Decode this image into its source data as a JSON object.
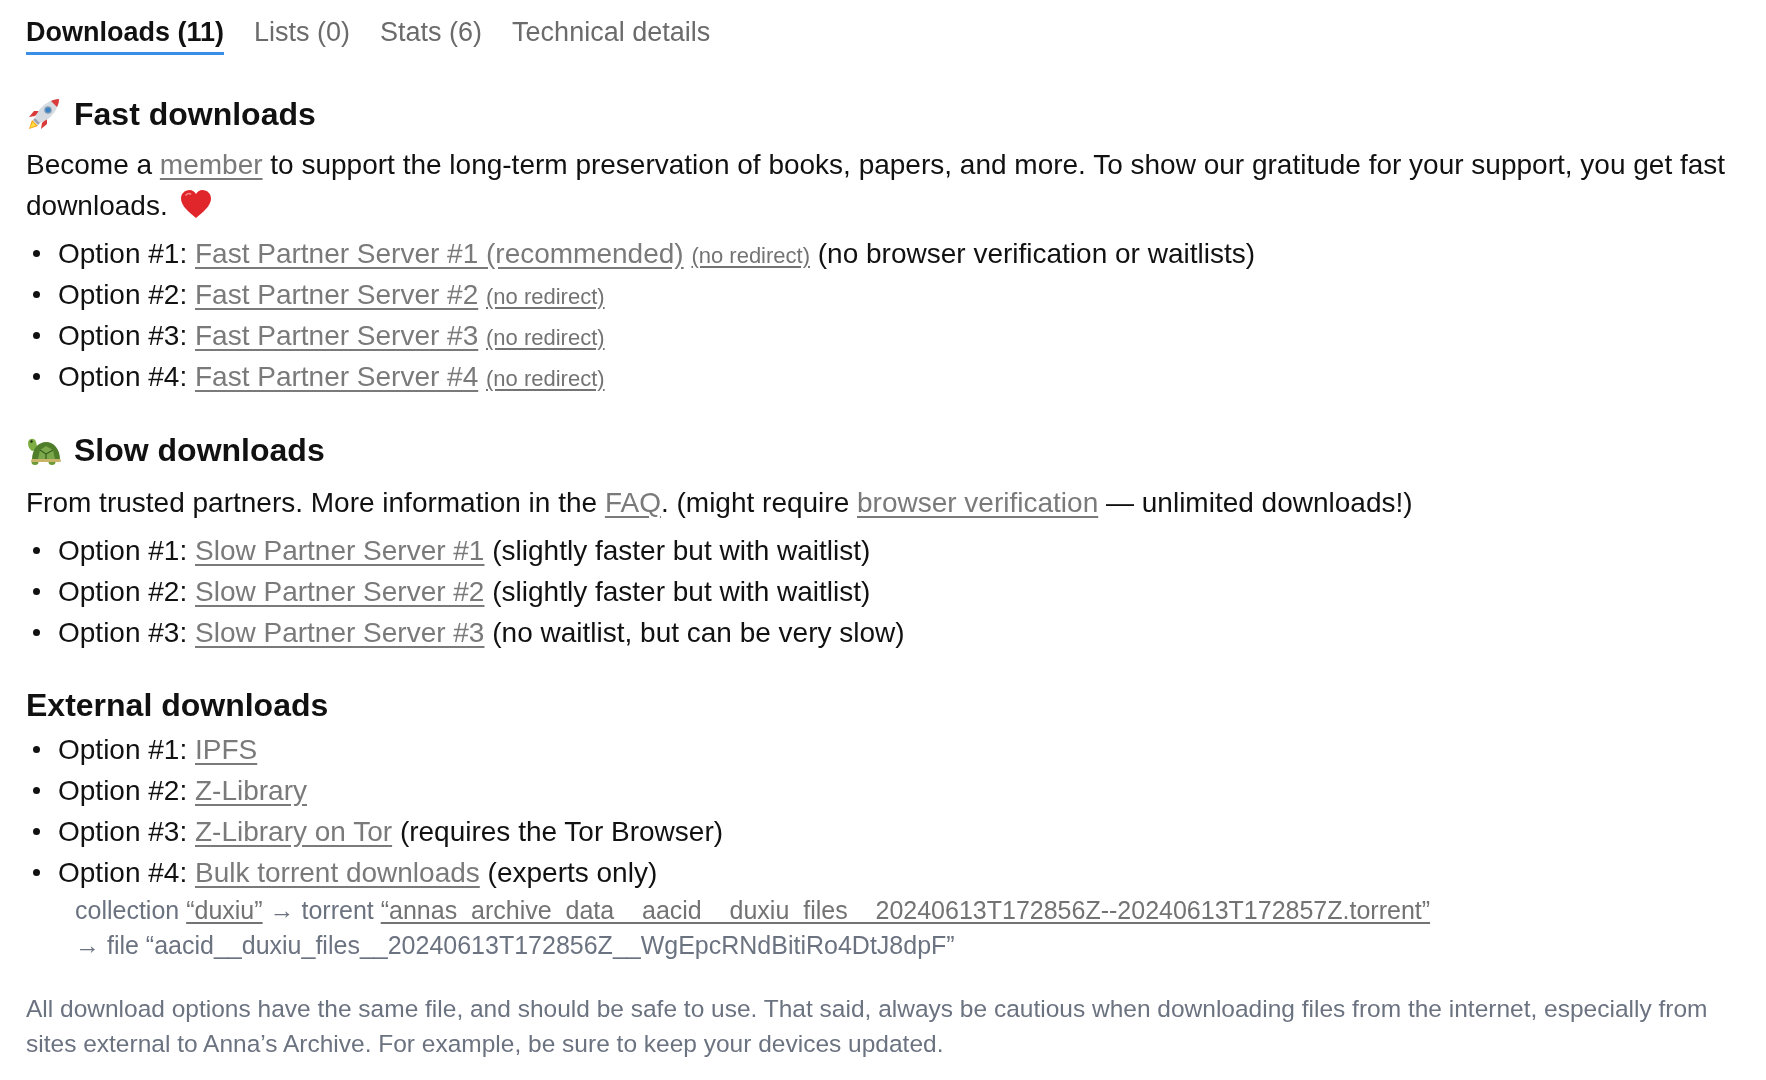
{
  "tabs": [
    {
      "label": "Downloads (11)",
      "selected": true
    },
    {
      "label": "Lists (0)",
      "selected": false
    },
    {
      "label": "Stats (6)",
      "selected": false
    },
    {
      "label": "Technical details",
      "selected": false
    }
  ],
  "sections": [
    {
      "kind": "fast",
      "title": "Fast downloads",
      "intro": [
        {
          "kind": "text",
          "text": "Become a "
        },
        {
          "kind": "link",
          "text": "member"
        },
        {
          "kind": "text",
          "text": " to support the long-term preservation of books, papers, and more. To show our gratitude for your support, you get fast downloads."
        }
      ],
      "options": [
        {
          "label": "Option #1:",
          "link": "Fast Partner Server #1 (recommended)",
          "extra_link": "(no redirect)",
          "note": "(no browser verification or waitlists)"
        },
        {
          "label": "Option #2:",
          "link": "Fast Partner Server #2",
          "extra_link": "(no redirect)"
        },
        {
          "label": "Option #3:",
          "link": "Fast Partner Server #3",
          "extra_link": "(no redirect)"
        },
        {
          "label": "Option #4:",
          "link": "Fast Partner Server #4",
          "extra_link": "(no redirect)"
        }
      ]
    },
    {
      "kind": "slow",
      "title": "Slow downloads",
      "intro": [
        {
          "kind": "text",
          "text": "From trusted partners. More information in the "
        },
        {
          "kind": "link",
          "text": "FAQ"
        },
        {
          "kind": "text",
          "text": ". (might require "
        },
        {
          "kind": "link",
          "text": "browser verification"
        },
        {
          "kind": "text",
          "text": " — unlimited downloads!)"
        }
      ],
      "options": [
        {
          "label": "Option #1:",
          "link": "Slow Partner Server #1",
          "note": "(slightly faster but with waitlist)"
        },
        {
          "label": "Option #2:",
          "link": "Slow Partner Server #2",
          "note": "(slightly faster but with waitlist)"
        },
        {
          "label": "Option #3:",
          "link": "Slow Partner Server #3",
          "note": "(no waitlist, but can be very slow)"
        }
      ]
    },
    {
      "kind": "external",
      "title": "External downloads",
      "options": [
        {
          "label": "Option #1:",
          "link": "IPFS"
        },
        {
          "label": "Option #2:",
          "link": "Z-Library"
        },
        {
          "label": "Option #3:",
          "link": "Z-Library on Tor",
          "note": "(requires the Tor Browser)"
        },
        {
          "label": "Option #4:",
          "link": "Bulk torrent downloads",
          "note": "(experts only)",
          "details": [
            [
              {
                "kind": "text",
                "text": "collection "
              },
              {
                "kind": "link",
                "text": "“duxiu”"
              },
              {
                "kind": "text",
                "text": " → torrent "
              },
              {
                "kind": "link",
                "text": "“annas_archive_data__aacid__duxiu_files__20240613T172856Z--20240613T172857Z.torrent”"
              }
            ],
            [
              {
                "kind": "text",
                "text": "→ file “aacid__duxiu_files__20240613T172856Z__WgEpcRNdBitiRo4DtJ8dpF”"
              }
            ]
          ]
        }
      ]
    }
  ],
  "footer": "All download options have the same file, and should be safe to use. That said, always be cautious when downloading files from the internet, especially from sites external to Anna’s Archive. For example, be sure to keep your devices updated."
}
